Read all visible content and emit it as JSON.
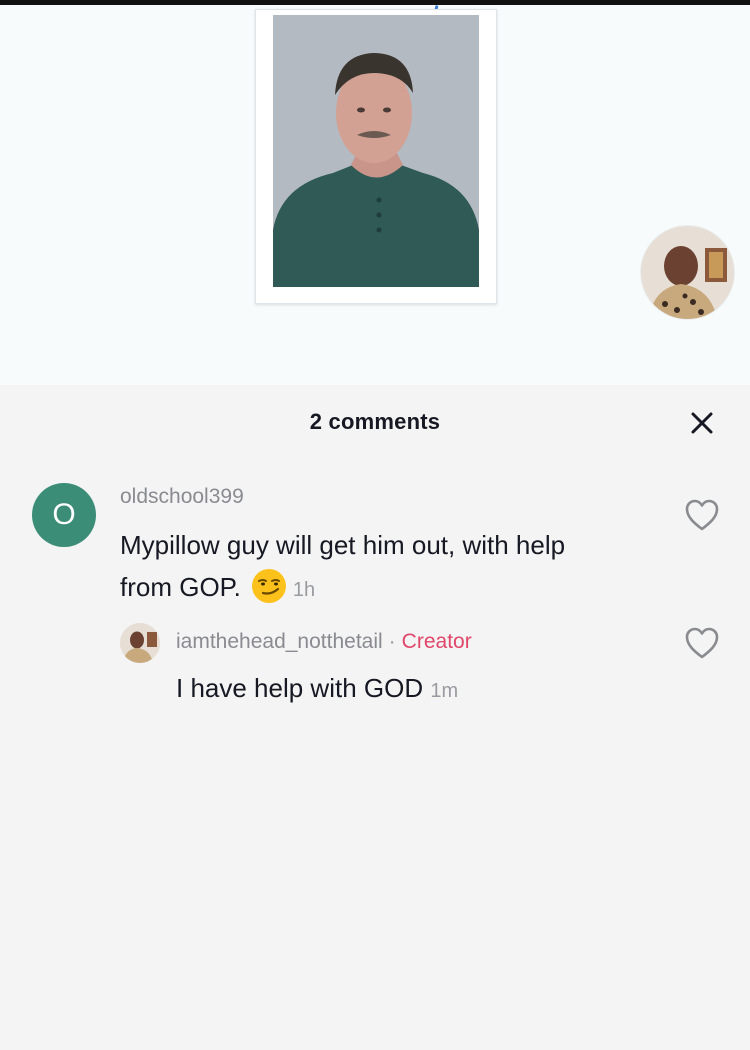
{
  "video": {
    "colors": {
      "background": "#f7fbfb",
      "frame": "#ffffff"
    }
  },
  "panel": {
    "title": "2 comments",
    "close_icon": "close-icon"
  },
  "comments": [
    {
      "avatar_letter": "O",
      "avatar_color": "#3b8d77",
      "username": "oldschool399",
      "text_line1": "Mypillow guy will get him out, with help",
      "text_line2": "from GOP.",
      "emoji": "smirking-face-emoji",
      "time": "1h",
      "like_icon": "heart-outline-icon"
    }
  ],
  "replies": [
    {
      "username": "iamthehead_notthetail",
      "separator": "·",
      "badge": "Creator",
      "badge_color": "#e0476a",
      "text": "I have help with GOD",
      "time": "1m",
      "like_icon": "heart-outline-icon"
    }
  ]
}
